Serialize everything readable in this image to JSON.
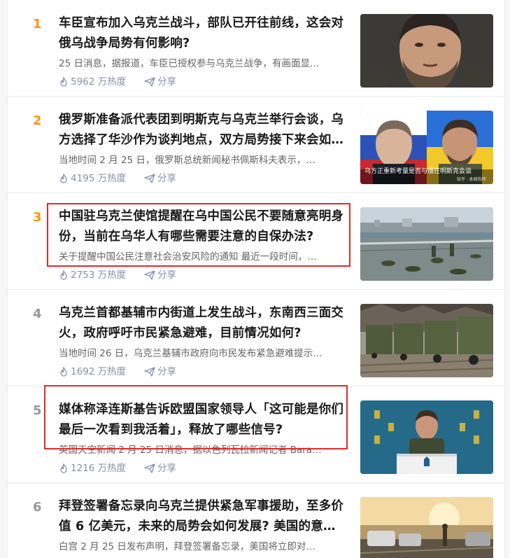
{
  "colors": {
    "rank_top": "#ff9607",
    "rank_normal": "#999999",
    "highlight": "#e02a2a",
    "meta": "#8590a6"
  },
  "items": [
    {
      "rank": "1",
      "title": "车臣宣布加入乌克兰战斗，部队已开往前线，这会对俄乌战争局势有何影响?",
      "excerpt": "25 日消息，据报道，车臣已授权参与乌克兰战争，有画面显…",
      "heat": "5962 万热度",
      "share": "分享",
      "thumb_icon": "man-portrait-thumbnail"
    },
    {
      "rank": "2",
      "title": "俄罗斯准备派代表团到明斯克与乌克兰举行会谈，乌方选择了华沙作为谈判地点，双方局势接下来会如…",
      "excerpt": "当地时间 2 月 25 日，俄罗斯总统新闻秘书佩斯科夫表示，…",
      "heat": "4195 万热度",
      "share": "分享",
      "thumb_icon": "two-leaders-thumbnail",
      "thumb_caption": "乌方正重新考量是否与俄在明斯克会谈",
      "thumb_watermark": "知乎 · 本周热榜"
    },
    {
      "rank": "3",
      "title": "中国驻乌克兰使馆提醒在乌中国公民不要随意亮明身份，当前在乌华人有哪些需要注意的自保办法?",
      "excerpt": "关于提醒中国公民注意社会治安风险的通知 最近一段时间，…",
      "heat": "2753 万热度",
      "share": "分享",
      "thumb_icon": "soldiers-bridge-thumbnail"
    },
    {
      "rank": "4",
      "title": "乌克兰首都基辅市内街道上发生战斗，东南西三面交火，政府呼吁市民紧急避难，目前情况如何?",
      "excerpt": "当地时间 26 日，乌克兰基辅市政府向市民发布紧急避难提示…",
      "heat": "1692 万热度",
      "share": "分享",
      "thumb_icon": "military-trucks-thumbnail"
    },
    {
      "rank": "5",
      "title": "媒体称泽连斯基告诉欧盟国家领导人「这可能是你们最后一次看到我活着」，释放了哪些信号?",
      "excerpt": "英国天空新闻 2 月 25 日消息，据以色列瓦拉新闻记者 Bara…",
      "heat": "1216 万热度",
      "share": "分享",
      "thumb_icon": "speaker-podium-thumbnail"
    },
    {
      "rank": "6",
      "title": "拜登签署备忘录向乌克兰提供紧急军事援助，至多价值 6 亿美元，未来的局势会如何发展? 美国的意…",
      "excerpt": "白宫 2 月 25 日发布声明，拜登签署备忘录，美国将立即对…",
      "heat": "",
      "share": "",
      "thumb_icon": "road-sunset-thumbnail"
    }
  ]
}
